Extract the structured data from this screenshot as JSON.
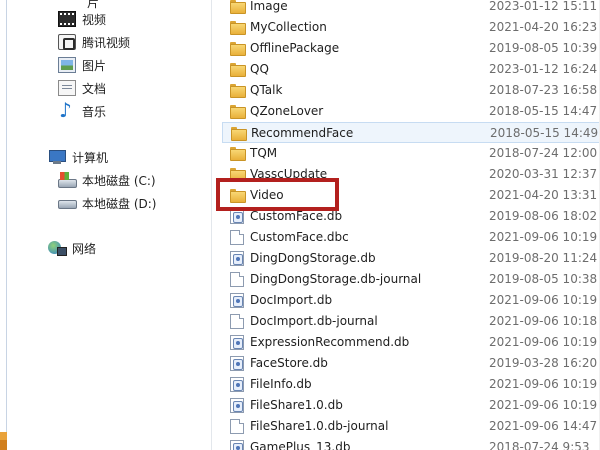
{
  "nav": {
    "cut_top_label": "片",
    "items": [
      {
        "label": "视频",
        "icon": "video-icon"
      },
      {
        "label": "腾讯视频",
        "icon": "tencent-video-icon"
      },
      {
        "label": "图片",
        "icon": "picture-icon"
      },
      {
        "label": "文档",
        "icon": "document-icon"
      },
      {
        "label": "音乐",
        "icon": "music-icon"
      }
    ],
    "computer": {
      "label": "计算机",
      "icon": "computer-icon"
    },
    "drives": [
      {
        "label": "本地磁盘 (C:)",
        "icon": "drive-c-icon"
      },
      {
        "label": "本地磁盘 (D:)",
        "icon": "drive-icon"
      }
    ],
    "network": {
      "label": "网络",
      "icon": "network-icon"
    }
  },
  "files": [
    {
      "name": "Image",
      "date": "2023-01-12 15:11",
      "type": "folder"
    },
    {
      "name": "MyCollection",
      "date": "2021-04-20 16:23",
      "type": "folder"
    },
    {
      "name": "OfflinePackage",
      "date": "2019-08-05 10:39",
      "type": "folder"
    },
    {
      "name": "QQ",
      "date": "2023-01-12 16:24",
      "type": "folder"
    },
    {
      "name": "QTalk",
      "date": "2018-07-23 16:58",
      "type": "folder"
    },
    {
      "name": "QZoneLover",
      "date": "2018-05-15 14:47",
      "type": "folder"
    },
    {
      "name": "RecommendFace",
      "date": "2018-05-15 14:49",
      "type": "folder",
      "selected": true
    },
    {
      "name": "TQM",
      "date": "2018-07-24 12:00",
      "type": "folder"
    },
    {
      "name": "VasscUpdate",
      "date": "2020-03-31 12:37",
      "type": "folder"
    },
    {
      "name": "Video",
      "date": "2021-04-20 13:31",
      "type": "folder",
      "highlighted": true
    },
    {
      "name": "CustomFace.db",
      "date": "2019-08-06 18:02",
      "type": "db"
    },
    {
      "name": "CustomFace.dbc",
      "date": "2021-09-06 10:19",
      "type": "blank"
    },
    {
      "name": "DingDongStorage.db",
      "date": "2019-08-20 11:24",
      "type": "db"
    },
    {
      "name": "DingDongStorage.db-journal",
      "date": "2019-08-05 10:38",
      "type": "blank"
    },
    {
      "name": "DocImport.db",
      "date": "2021-09-06 10:19",
      "type": "db"
    },
    {
      "name": "DocImport.db-journal",
      "date": "2021-09-06 10:18",
      "type": "blank"
    },
    {
      "name": "ExpressionRecommend.db",
      "date": "2021-09-06 10:19",
      "type": "db"
    },
    {
      "name": "FaceStore.db",
      "date": "2019-03-28 16:20",
      "type": "db"
    },
    {
      "name": "FileInfo.db",
      "date": "2021-09-06 10:19",
      "type": "db"
    },
    {
      "name": "FileShare1.0.db",
      "date": "2021-09-06 10:19",
      "type": "db"
    },
    {
      "name": "FileShare1.0.db-journal",
      "date": "2021-09-06 14:47",
      "type": "blank"
    },
    {
      "name": "GamePlus_13.db",
      "date": "2018-07-24 9:53",
      "type": "db"
    }
  ],
  "colors": {
    "highlight_border": "#b3201e",
    "selected_row_bg": "#eef5fc",
    "folder_yellow": "#f8d774"
  }
}
